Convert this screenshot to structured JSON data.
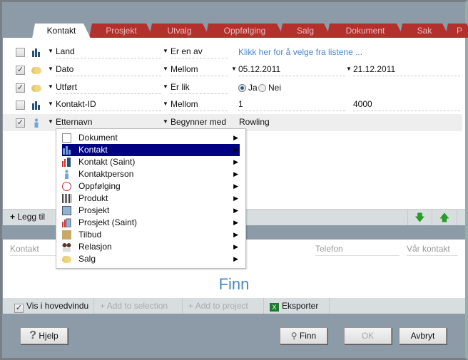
{
  "tabs": [
    "Kontakt",
    "Prosjekt",
    "Utvalg",
    "Oppfølging",
    "Salg",
    "Dokument",
    "Sak",
    "P"
  ],
  "criteria": [
    {
      "checked": false,
      "icon": "company-icon",
      "field": "Land",
      "operator": "Er en av",
      "value1": "Klikk her for å velge fra listene ...",
      "value2": ""
    },
    {
      "checked": true,
      "icon": "coins-icon",
      "field": "Dato",
      "operator": "Mellom",
      "value1": "05.12.2011",
      "value2": "21.12.2011"
    },
    {
      "checked": true,
      "icon": "coins-icon",
      "field": "Utført",
      "operator": "Er lik",
      "radio": {
        "options": [
          "Ja",
          "Nei"
        ],
        "selected": "Ja"
      }
    },
    {
      "checked": false,
      "icon": "company-icon",
      "field": "Kontakt-ID",
      "operator": "Mellom",
      "value1": "1",
      "value2": "4000"
    },
    {
      "checked": true,
      "icon": "person-icon",
      "field": "Etternavn",
      "operator": "Begynner med",
      "value1": "Rowling",
      "value2": ""
    }
  ],
  "menu": {
    "items": [
      "Dokument",
      "Kontakt",
      "Kontakt (Saint)",
      "Kontaktperson",
      "Oppfølging",
      "Produkt",
      "Prosjekt",
      "Prosjekt (Saint)",
      "Tilbud",
      "Relasjon",
      "Salg"
    ],
    "highlighted": "Kontakt"
  },
  "toolbar": {
    "add_label": "Legg til"
  },
  "results": {
    "columns": [
      "Kontakt",
      "Telefon",
      "Vår kontakt"
    ],
    "find_label": "Finn"
  },
  "bottombar": {
    "show_in_main": "Vis i hovedvindu",
    "show_in_main_checked": true,
    "add_selection": "Add to selection",
    "add_project": "Add to project",
    "export": "Eksporter"
  },
  "buttons": {
    "help": "Hjelp",
    "find": "Finn",
    "ok": "OK",
    "cancel": "Avbryt"
  },
  "colors": {
    "tab_red": "#b3302d",
    "highlight": "#000080",
    "link": "#4a86c8"
  }
}
